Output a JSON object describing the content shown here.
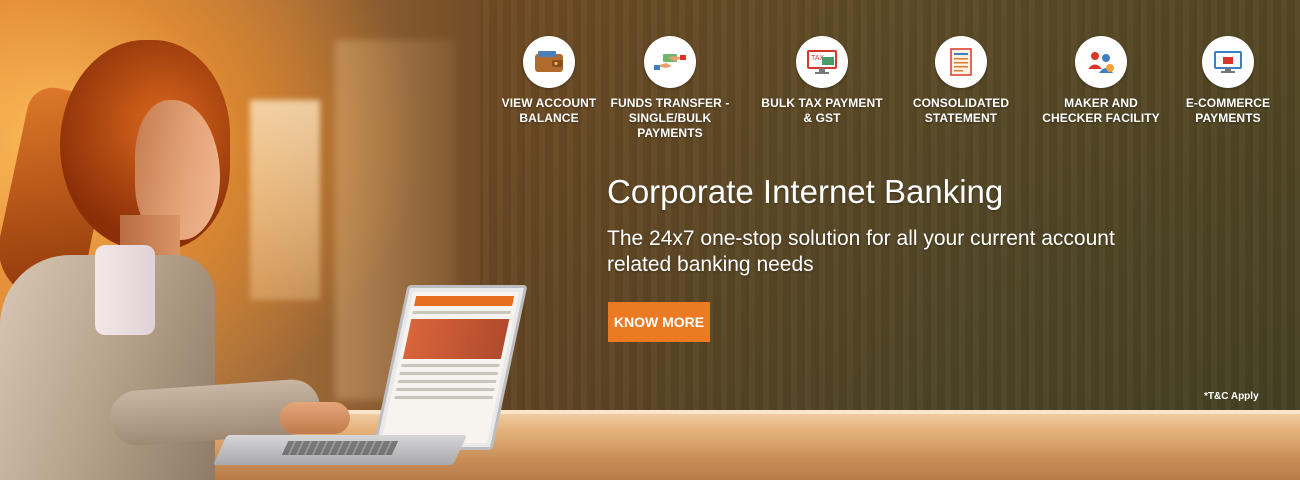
{
  "features": [
    {
      "icon": "wallet-icon",
      "label": "VIEW ACCOUNT\nBALANCE"
    },
    {
      "icon": "money-transfer-icon",
      "label": "FUNDS TRANSFER -\nSINGLE/BULK PAYMENTS"
    },
    {
      "icon": "tax-payment-icon",
      "label": "BULK TAX PAYMENT\n& GST"
    },
    {
      "icon": "statement-icon",
      "label": "CONSOLIDATED\nSTATEMENT"
    },
    {
      "icon": "users-icon",
      "label": "MAKER AND\nCHECKER FACILITY"
    },
    {
      "icon": "ecommerce-icon",
      "label": "E-COMMERCE\nPAYMENTS"
    }
  ],
  "hero": {
    "title": "Corporate Internet Banking",
    "subtitle": "The 24x7 one-stop solution for all your current account related banking needs",
    "cta_label": "KNOW MORE",
    "disclaimer": "*T&C Apply"
  },
  "colors": {
    "accent": "#ec7a22",
    "icon_red": "#d9362b",
    "icon_blue": "#3c7fc2"
  }
}
